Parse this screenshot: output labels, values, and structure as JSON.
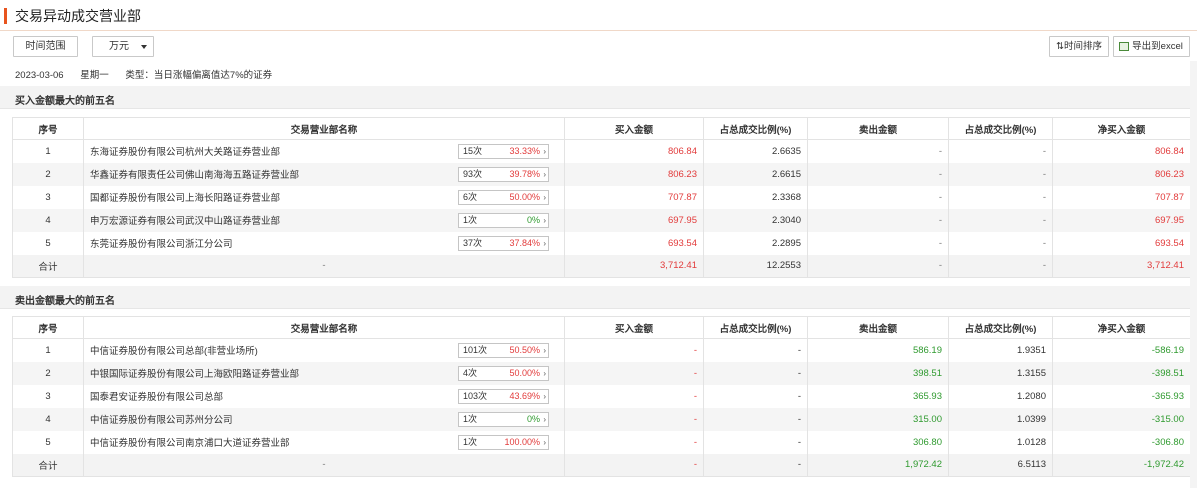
{
  "page": {
    "title": "交易异动成交营业部"
  },
  "toolbar": {
    "range_label": "时间范围",
    "unit_value": "万元",
    "sort_label": "⇅时间排序",
    "export_label": "导出到excel"
  },
  "info": {
    "date": "2023-03-06",
    "weekday": "星期一",
    "type": "类型：当日涨幅偏离值达7%的证券"
  },
  "headers": [
    "序号",
    "交易营业部名称",
    "买入金额",
    "占总成交比例(%)",
    "卖出金额",
    "占总成交比例(%)",
    "净买入金额"
  ],
  "buy_section": {
    "title": "买入金额最大的前五名",
    "rows": [
      {
        "no": "1",
        "name": "东海证券股份有限公司杭州大关路证券营业部",
        "count": "15次",
        "rate": "33.33%",
        "buy": "806.84",
        "buy_pct": "2.6635",
        "sell": "-",
        "sell_pct": "-",
        "net": "806.84"
      },
      {
        "no": "2",
        "name": "华鑫证券有限责任公司佛山南海海五路证券营业部",
        "count": "93次",
        "rate": "39.78%",
        "buy": "806.23",
        "buy_pct": "2.6615",
        "sell": "-",
        "sell_pct": "-",
        "net": "806.23"
      },
      {
        "no": "3",
        "name": "国都证券股份有限公司上海长阳路证券营业部",
        "count": "6次",
        "rate": "50.00%",
        "buy": "707.87",
        "buy_pct": "2.3368",
        "sell": "-",
        "sell_pct": "-",
        "net": "707.87"
      },
      {
        "no": "4",
        "name": "申万宏源证券有限公司武汉中山路证券营业部",
        "count": "1次",
        "rate": "0%",
        "buy": "697.95",
        "buy_pct": "2.3040",
        "sell": "-",
        "sell_pct": "-",
        "net": "697.95"
      },
      {
        "no": "5",
        "name": "东莞证券股份有限公司浙江分公司",
        "count": "37次",
        "rate": "37.84%",
        "buy": "693.54",
        "buy_pct": "2.2895",
        "sell": "-",
        "sell_pct": "-",
        "net": "693.54"
      }
    ],
    "total": {
      "label": "合计",
      "name": "-",
      "buy": "3,712.41",
      "buy_pct": "12.2553",
      "sell": "-",
      "sell_pct": "-",
      "net": "3,712.41"
    }
  },
  "sell_section": {
    "title": "卖出金额最大的前五名",
    "rows": [
      {
        "no": "1",
        "name": "中信证券股份有限公司总部(非营业场所)",
        "count": "101次",
        "rate": "50.50%",
        "buy": "-",
        "buy_pct": "-",
        "sell": "586.19",
        "sell_pct": "1.9351",
        "net": "-586.19"
      },
      {
        "no": "2",
        "name": "中银国际证券股份有限公司上海欧阳路证券营业部",
        "count": "4次",
        "rate": "50.00%",
        "buy": "-",
        "buy_pct": "-",
        "sell": "398.51",
        "sell_pct": "1.3155",
        "net": "-398.51"
      },
      {
        "no": "3",
        "name": "国泰君安证券股份有限公司总部",
        "count": "103次",
        "rate": "43.69%",
        "buy": "-",
        "buy_pct": "-",
        "sell": "365.93",
        "sell_pct": "1.2080",
        "net": "-365.93"
      },
      {
        "no": "4",
        "name": "中信证券股份有限公司苏州分公司",
        "count": "1次",
        "rate": "0%",
        "buy": "-",
        "buy_pct": "-",
        "sell": "315.00",
        "sell_pct": "1.0399",
        "net": "-315.00"
      },
      {
        "no": "5",
        "name": "中信证券股份有限公司南京浦口大道证券营业部",
        "count": "1次",
        "rate": "100.00%",
        "buy": "-",
        "buy_pct": "-",
        "sell": "306.80",
        "sell_pct": "1.0128",
        "net": "-306.80"
      }
    ],
    "total": {
      "label": "合计",
      "name": "-",
      "buy": "-",
      "buy_pct": "-",
      "sell": "1,972.42",
      "sell_pct": "6.5113",
      "net": "-1,972.42"
    }
  },
  "colors": {
    "accent": "#e8541e",
    "up": "#e23b3b",
    "down": "#2f9a2f"
  }
}
